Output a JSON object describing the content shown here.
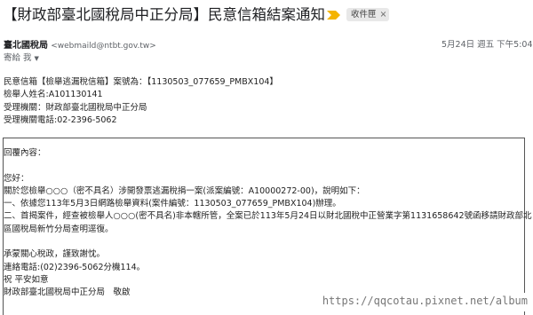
{
  "subject": "【財政部臺北國稅局中正分局】民意信箱結案通知",
  "label": "收件匣",
  "label_close": "×",
  "sender": {
    "name": "臺北國稅局",
    "email": "<webmaild@ntbt.gov.tw>",
    "date": "5月24日 週五 下午5:04",
    "to": "寄給 我"
  },
  "header_lines": [
    "民意信箱【檢舉逃漏稅信箱】案號為：【1130503_077659_PMBX104】",
    "檢舉人姓名:A101130141",
    "受理機關：財政部臺北國稅局中正分局",
    "受理機關電話:02-2396-5062"
  ],
  "reply_lines": [
    "回覆內容：",
    "",
    "您好：",
    "關於您檢舉○○○（密不具名）涉開發票逃漏稅捐一案(派案編號：A10000272-00)，說明如下：",
    "一、依據您113年5月3日網路檢舉資料(案件編號：1130503_077659_PMBX104)辦理。",
    "二、首揭案件，經查被檢舉人○○○(密不具名)非本轄所管，全案已於113年5月24日以財北國稅中正營業字第1131658642號函移請財政部北",
    "區國稅局新竹分局查明逕復。",
    "",
    "承蒙關心稅政，謹致謝忱。",
    "連絡電話:(02)2396-5062分機114。",
    "祝 平安如意",
    "財政部臺北國稅局中正分局　敬啟"
  ],
  "watermark": "https://qqcotau.pixnet.net/album",
  "colors": {
    "importance_marker": "#f4b400",
    "label_bg": "#e8e8e8",
    "muted_text": "#5f6368"
  }
}
